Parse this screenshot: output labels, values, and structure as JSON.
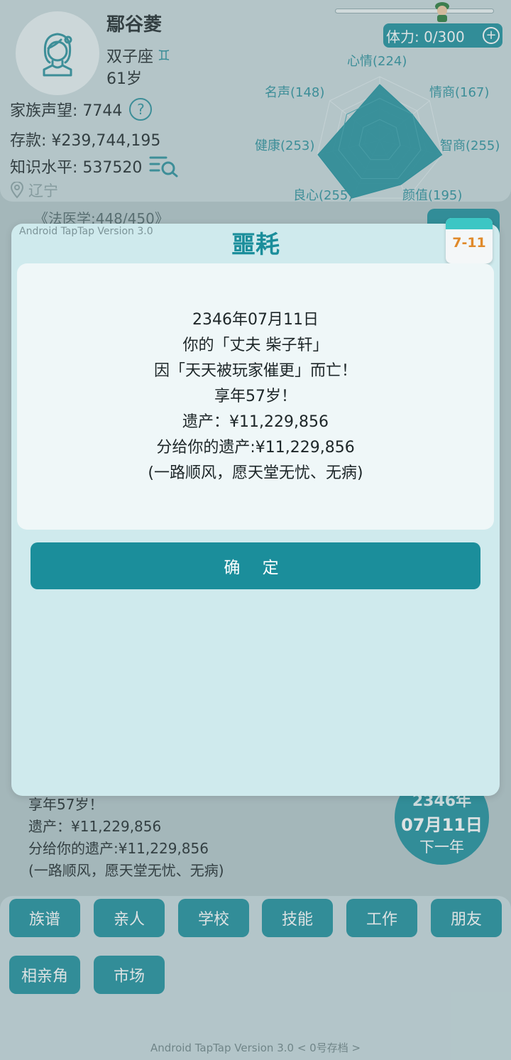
{
  "profile": {
    "name": "鄢谷菱",
    "zodiac": "双子座",
    "zodiac_icon": "gemini-icon",
    "age": "61岁",
    "reputation": "家族声望: 7744",
    "savings": "存款: ¥239,744,195",
    "knowledge": "知识水平: 537520",
    "location": "辽宁"
  },
  "energy": {
    "label": "体力: 0/300",
    "plus": "+"
  },
  "radar": {
    "labels": {
      "mood": "心情(224)",
      "eq": "情商(167)",
      "iq": "智商(255)",
      "looks": "颜值(195)",
      "conscience": "良心(255)",
      "health": "健康(253)",
      "fame": "名声(148)"
    },
    "values": [
      224,
      167,
      255,
      195,
      255,
      253,
      148
    ],
    "max": 255,
    "fill_color": "#1b8e9b"
  },
  "background": {
    "course": "《法医学:448/450》",
    "log_lines": [
      "享年57岁！",
      "遗产：¥11,229,856",
      "分给你的遗产:¥11,229,856",
      "(一路顺风，愿天堂无忧、无病)"
    ],
    "date_year": "2346年",
    "date_day": "07月11日",
    "next_year": "下一年"
  },
  "nav": {
    "genealogy": "族谱",
    "relatives": "亲人",
    "school": "学校",
    "skills": "技能",
    "work": "工作",
    "friends": "朋友",
    "matchmaking": "相亲角",
    "market": "市场"
  },
  "footer": "Android TapTap Version 3.0  < 0号存档 >",
  "modal": {
    "version": "Android TapTap Version 3.0",
    "title": "噩耗",
    "calendar_date": "7-11",
    "lines": [
      "2346年07月11日",
      "你的「丈夫 柴子轩」",
      "因「天天被玩家催更」而亡！",
      "享年57岁！",
      "遗产：¥11,229,856",
      "分给你的遗产:¥11,229,856",
      "(一路顺风，愿天堂无忧、无病)"
    ],
    "confirm": "确 定"
  }
}
